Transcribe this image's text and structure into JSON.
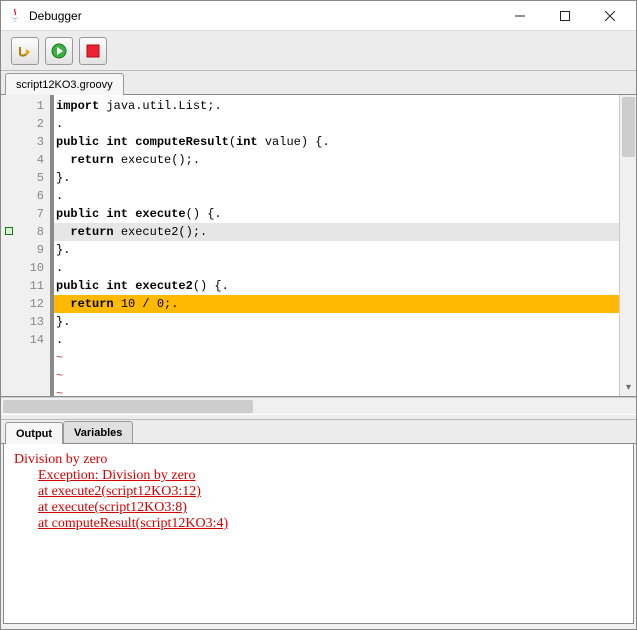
{
  "window": {
    "title": "Debugger"
  },
  "toolbar": {
    "buttons": [
      "step",
      "run",
      "stop"
    ]
  },
  "file_tab": {
    "label": "script12KO3.groovy"
  },
  "editor": {
    "breakpoint_line": 8,
    "execution_line": 12,
    "lines": [
      {
        "n": 1,
        "segs": [
          {
            "t": "import",
            "k": true
          },
          {
            "t": " java.util.List;."
          }
        ]
      },
      {
        "n": 2,
        "segs": [
          {
            "t": "."
          }
        ]
      },
      {
        "n": 3,
        "segs": [
          {
            "t": "public int computeResult",
            "k": true
          },
          {
            "t": "("
          },
          {
            "t": "int",
            "k": true
          },
          {
            "t": " value) {."
          }
        ]
      },
      {
        "n": 4,
        "segs": [
          {
            "t": "  "
          },
          {
            "t": "return",
            "k": true
          },
          {
            "t": " execute();."
          }
        ]
      },
      {
        "n": 5,
        "segs": [
          {
            "t": "}."
          }
        ]
      },
      {
        "n": 6,
        "segs": [
          {
            "t": "."
          }
        ]
      },
      {
        "n": 7,
        "segs": [
          {
            "t": "public int execute",
            "k": true
          },
          {
            "t": "() {."
          }
        ]
      },
      {
        "n": 8,
        "segs": [
          {
            "t": "  "
          },
          {
            "t": "return",
            "k": true
          },
          {
            "t": " execute2();."
          }
        ]
      },
      {
        "n": 9,
        "segs": [
          {
            "t": "}."
          }
        ]
      },
      {
        "n": 10,
        "segs": [
          {
            "t": "."
          }
        ]
      },
      {
        "n": 11,
        "segs": [
          {
            "t": "public int execute2",
            "k": true
          },
          {
            "t": "() {."
          }
        ]
      },
      {
        "n": 12,
        "segs": [
          {
            "t": "  "
          },
          {
            "t": "return",
            "k": true
          },
          {
            "t": " 10 / 0;."
          }
        ]
      },
      {
        "n": 13,
        "segs": [
          {
            "t": "}."
          }
        ]
      },
      {
        "n": 14,
        "segs": [
          {
            "t": "."
          }
        ]
      }
    ]
  },
  "bottom_tabs": {
    "active": "Output",
    "tabs": [
      "Output",
      "Variables"
    ]
  },
  "output": {
    "heading": "Division by zero",
    "exception": "Exception: Division by zero",
    "trace": [
      "at execute2(script12KO3:12)",
      "at execute(script12KO3:8)",
      "at computeResult(script12KO3:4)"
    ]
  }
}
